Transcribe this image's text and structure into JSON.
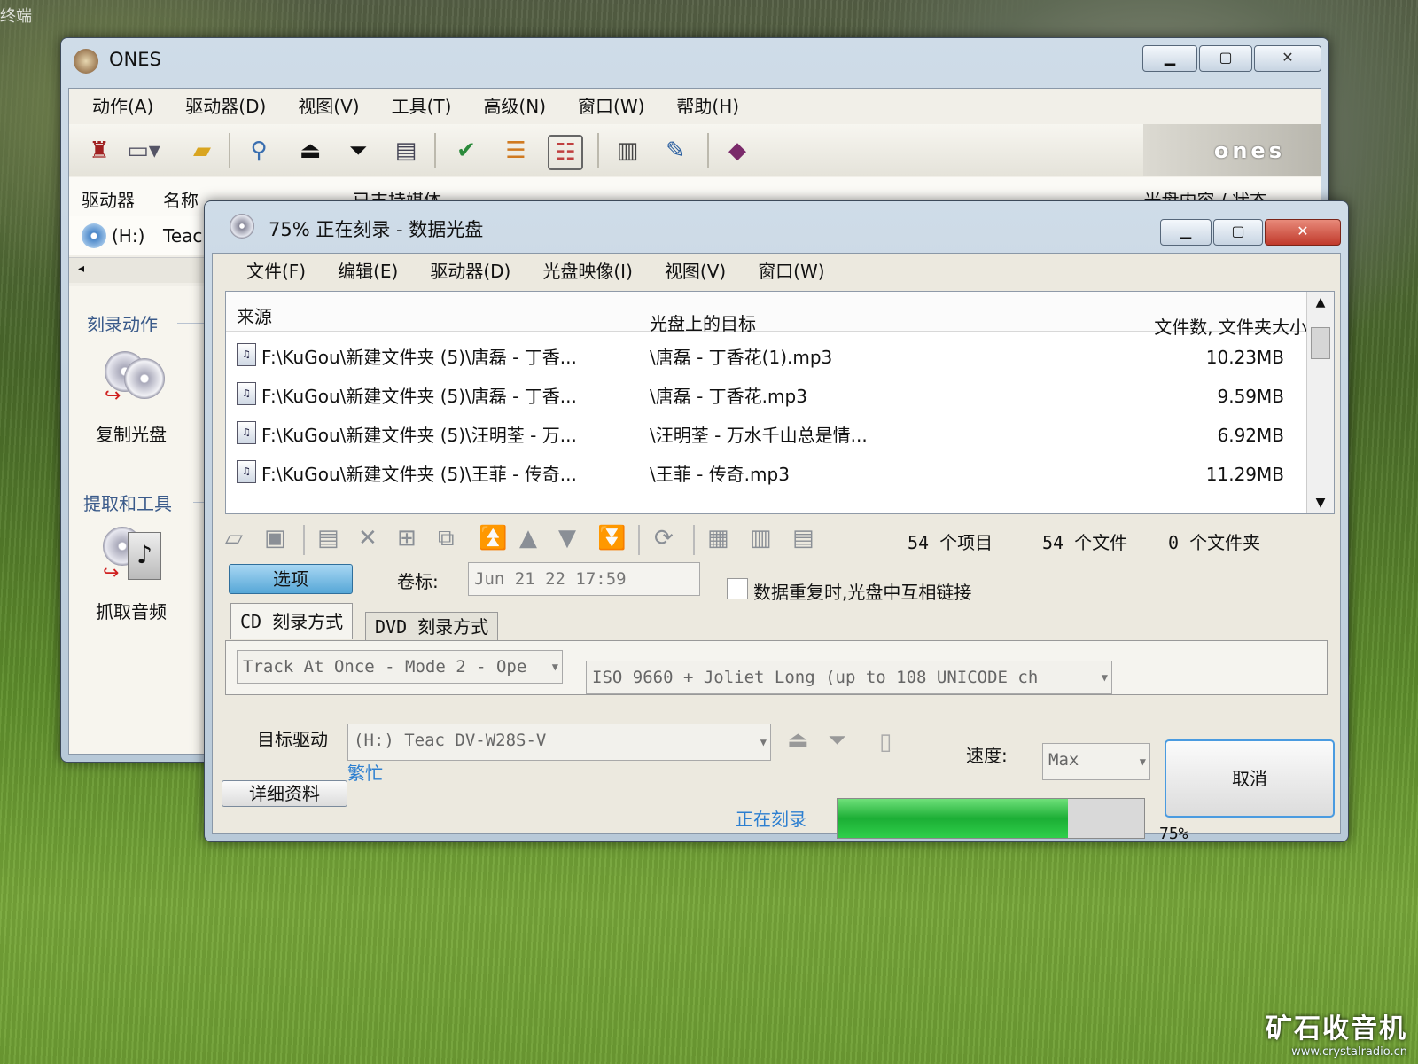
{
  "desktop": {
    "corner_text": "终端",
    "watermark_title": "矿石收音机",
    "watermark_url": "www.crystalradio.cn"
  },
  "main_window": {
    "title": "ONES",
    "menu": [
      "动作(A)",
      "驱动器(D)",
      "视图(V)",
      "工具(T)",
      "高级(N)",
      "窗口(W)",
      "帮助(H)"
    ],
    "brand": "ones",
    "drives_header": {
      "col_drive": "驱动器",
      "col_name": "名称",
      "col_media": "已支持媒体",
      "col_status": "光盘内容 / 状态"
    },
    "drive_row": {
      "letter": "(H:)",
      "name": "Teac"
    },
    "left_pane": {
      "section_burn": "刻录动作",
      "copy_disc": "复制光盘",
      "section_extract": "提取和工具",
      "rip_audio": "抓取音频"
    }
  },
  "burn_window": {
    "title": "75% 正在刻录 - 数据光盘",
    "menu": [
      "文件(F)",
      "编辑(E)",
      "驱动器(D)",
      "光盘映像(I)",
      "视图(V)",
      "窗口(W)"
    ],
    "list": {
      "col_source": "来源",
      "col_target": "光盘上的目标",
      "col_size": "文件数, 文件夹大小",
      "rows": [
        {
          "source": "F:\\KuGou\\新建文件夹 (5)\\唐磊 - 丁香...",
          "target": "\\唐磊 - 丁香花(1).mp3",
          "size": "10.23MB"
        },
        {
          "source": "F:\\KuGou\\新建文件夹 (5)\\唐磊 - 丁香...",
          "target": "\\唐磊 - 丁香花.mp3",
          "size": "9.59MB"
        },
        {
          "source": "F:\\KuGou\\新建文件夹 (5)\\汪明荃 - 万...",
          "target": "\\汪明荃 - 万水千山总是情...",
          "size": "6.92MB"
        },
        {
          "source": "F:\\KuGou\\新建文件夹 (5)\\王菲 - 传奇...",
          "target": "\\王菲 - 传奇.mp3",
          "size": "11.29MB"
        }
      ]
    },
    "counts": {
      "items": "54 个项目",
      "files": "54 个文件",
      "folders": "0 个文件夹"
    },
    "options_button": "选项",
    "volume_label_caption": "卷标:",
    "volume_label_value": "Jun 21 22 17:59",
    "link_duplicates_label": "数据重复时,光盘中互相链接",
    "tabs": {
      "cd": "CD 刻录方式",
      "dvd": "DVD 刻录方式"
    },
    "write_mode": "Track At Once - Mode 2 - Ope",
    "filesystem": "ISO 9660 + Joliet Long (up to 108 UNICODE ch",
    "target_drive_label": "目标驱动",
    "target_drive_value": "(H:) Teac DV-W28S-V",
    "busy_text": "繁忙",
    "speed_label": "速度:",
    "speed_value": "Max",
    "cancel_button": "取消",
    "details_button": "详细资料",
    "status_text": "正在刻录",
    "progress_percent": 75,
    "progress_label": "75%"
  }
}
